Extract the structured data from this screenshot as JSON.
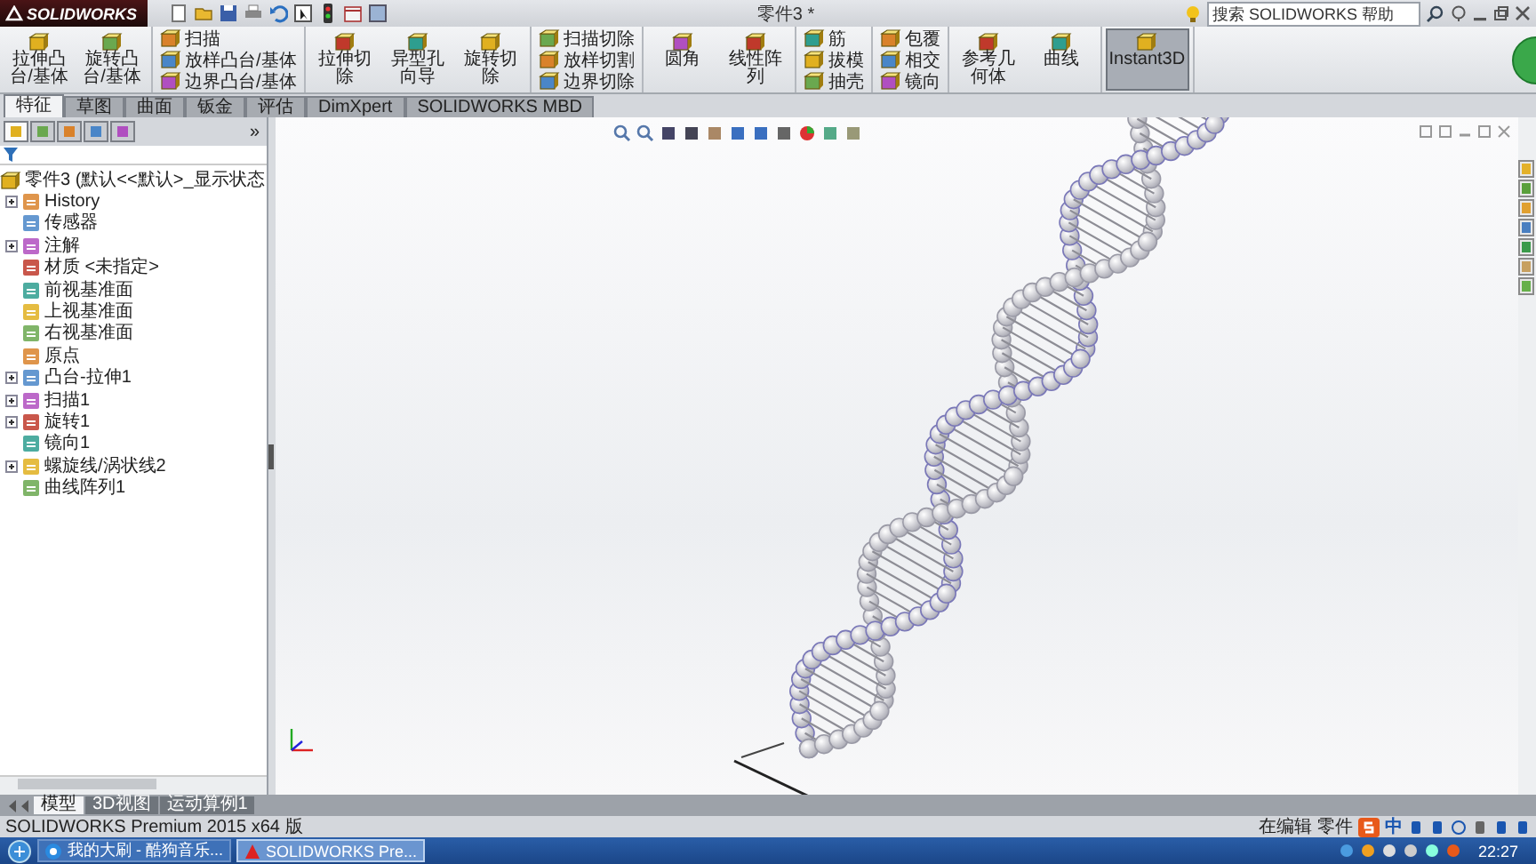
{
  "window": {
    "app_name": "SOLIDWORKS",
    "title": "零件3 *"
  },
  "search": {
    "placeholder": "搜索 SOLIDWORKS 帮助"
  },
  "ribbon": {
    "groups": [
      {
        "kind": "large",
        "buttons": [
          {
            "label": "拉伸凸台/基体",
            "pressed": false
          },
          {
            "label": "旋转凸台/基体",
            "pressed": false
          }
        ]
      },
      {
        "kind": "stack",
        "buttons": [
          {
            "label": "扫描",
            "pressed": false
          },
          {
            "label": "放样凸台/基体",
            "pressed": false
          },
          {
            "label": "边界凸台/基体",
            "pressed": false
          }
        ]
      },
      {
        "kind": "large",
        "buttons": [
          {
            "label": "拉伸切除",
            "pressed": false
          },
          {
            "label": "异型孔向导",
            "pressed": false
          },
          {
            "label": "旋转切除",
            "pressed": false
          }
        ]
      },
      {
        "kind": "stack",
        "buttons": [
          {
            "label": "扫描切除",
            "pressed": false
          },
          {
            "label": "放样切割",
            "pressed": false
          },
          {
            "label": "边界切除",
            "pressed": false
          }
        ]
      },
      {
        "kind": "large",
        "buttons": [
          {
            "label": "圆角",
            "pressed": false
          },
          {
            "label": "线性阵列",
            "pressed": false
          }
        ]
      },
      {
        "kind": "stack",
        "buttons": [
          {
            "label": "筋",
            "pressed": false
          },
          {
            "label": "拔模",
            "pressed": false
          },
          {
            "label": "抽壳",
            "pressed": false
          }
        ]
      },
      {
        "kind": "stack",
        "buttons": [
          {
            "label": "包覆",
            "pressed": false
          },
          {
            "label": "相交",
            "pressed": false
          },
          {
            "label": "镜向",
            "pressed": false
          }
        ]
      },
      {
        "kind": "large",
        "buttons": [
          {
            "label": "参考几何体",
            "pressed": false
          },
          {
            "label": "曲线",
            "pressed": false
          }
        ]
      },
      {
        "kind": "large",
        "buttons": [
          {
            "label": "Instant3D",
            "pressed": true
          }
        ]
      }
    ]
  },
  "command_tabs": [
    {
      "label": "特征",
      "selected": true
    },
    {
      "label": "草图",
      "selected": false
    },
    {
      "label": "曲面",
      "selected": false
    },
    {
      "label": "钣金",
      "selected": false
    },
    {
      "label": "评估",
      "selected": false
    },
    {
      "label": "DimXpert",
      "selected": false
    },
    {
      "label": "SOLIDWORKS MBD",
      "selected": false
    }
  ],
  "panel_tabs": {
    "tabs": [
      {
        "selected": true
      },
      {
        "selected": false
      },
      {
        "selected": false
      },
      {
        "selected": false
      },
      {
        "selected": false
      }
    ],
    "more": "»"
  },
  "feature_tree": {
    "root": {
      "label": "零件3 (默认<<默认>_显示状态",
      "children": [
        {
          "label": "History",
          "expander": true
        },
        {
          "label": "传感器",
          "expander": false
        },
        {
          "label": "注解",
          "expander": true
        },
        {
          "label": "材质 <未指定>",
          "expander": false
        },
        {
          "label": "前视基准面",
          "expander": false
        },
        {
          "label": "上视基准面",
          "expander": false
        },
        {
          "label": "右视基准面",
          "expander": false
        },
        {
          "label": "原点",
          "expander": false
        },
        {
          "label": "凸台-拉伸1",
          "expander": true
        },
        {
          "label": "扫描1",
          "expander": true
        },
        {
          "label": "旋转1",
          "expander": true
        },
        {
          "label": "镜向1",
          "expander": false
        },
        {
          "label": "螺旋线/涡状线2",
          "expander": true
        },
        {
          "label": "曲线阵列1",
          "expander": false
        }
      ]
    }
  },
  "view_tabs": [
    {
      "label": "模型",
      "selected": true
    },
    {
      "label": "3D视图",
      "selected": false
    },
    {
      "label": "运动算例1",
      "selected": false
    }
  ],
  "status_bar": {
    "product": "SOLIDWORKS Premium 2015 x64 版",
    "mode": "在编辑 零件",
    "ime": "中"
  },
  "taskbar": {
    "tasks": [
      {
        "label": "我的大刷 - 酷狗音乐...",
        "selected": false
      },
      {
        "label": "SOLIDWORKS Pre...",
        "selected": true
      }
    ],
    "clock": "22:27"
  }
}
